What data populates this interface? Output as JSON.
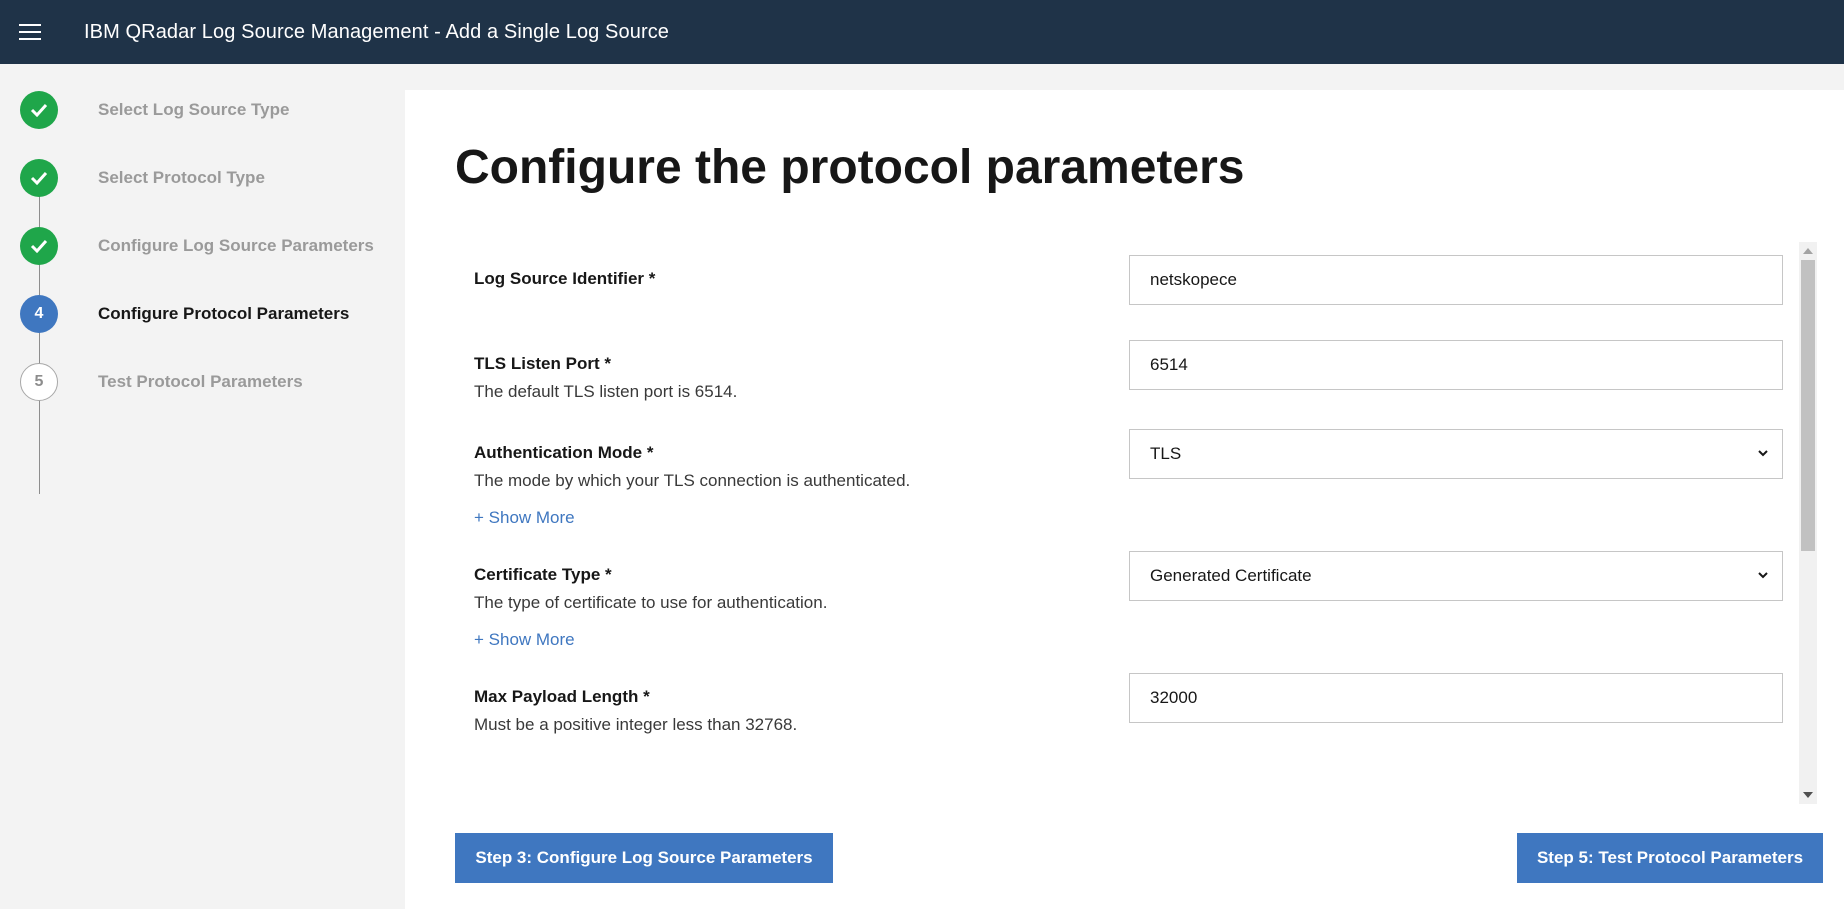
{
  "header": {
    "title": "IBM QRadar Log Source Management - Add a Single Log Source"
  },
  "steps": [
    {
      "number": "1",
      "label": "Select Log Source Type",
      "status": "done"
    },
    {
      "number": "2",
      "label": "Select Protocol Type",
      "status": "done"
    },
    {
      "number": "3",
      "label": "Configure Log Source Parameters",
      "status": "done"
    },
    {
      "number": "4",
      "label": "Configure Protocol Parameters",
      "status": "current"
    },
    {
      "number": "5",
      "label": "Test Protocol Parameters",
      "status": "todo"
    }
  ],
  "main": {
    "title": "Configure the protocol parameters",
    "fields": [
      {
        "label": "Log Source Identifier *",
        "value": "netskopece"
      },
      {
        "label": "TLS Listen Port *",
        "help": "The default TLS listen port is 6514.",
        "value": "6514"
      },
      {
        "label": "Authentication Mode *",
        "help": "The mode by which your TLS connection is authenticated.",
        "show_more": "+ Show More",
        "value": "TLS"
      },
      {
        "label": "Certificate Type *",
        "help": "The type of certificate to use for authentication.",
        "show_more": "+ Show More",
        "value": "Generated Certificate"
      },
      {
        "label": "Max Payload Length *",
        "help": "Must be a positive integer less than 32768.",
        "value": "32000"
      }
    ]
  },
  "buttons": {
    "prev": "Step 3: Configure Log Source Parameters",
    "next": "Step 5: Test Protocol Parameters"
  },
  "colors": {
    "header_bg": "#1f3348",
    "done": "#1fa64a",
    "accent": "#3f77c0"
  }
}
